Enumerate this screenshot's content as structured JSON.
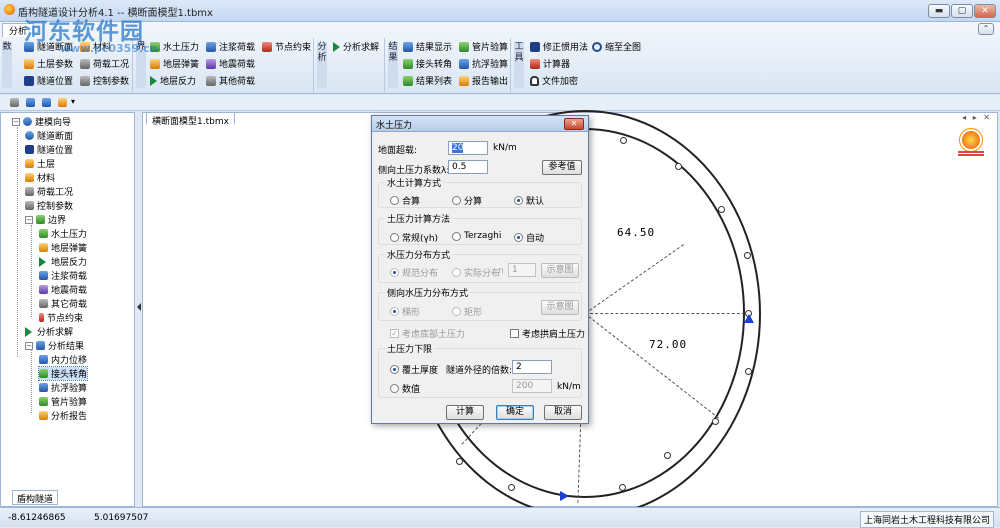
{
  "window": {
    "title": "盾构隧道设计分析4.1 -- 横断面模型1.tbmx",
    "min": "▬",
    "max": "▢",
    "close": "✕"
  },
  "watermark": {
    "text": "河东软件园",
    "url": "www.pc0359.cn"
  },
  "ribbon": {
    "tab": "分析",
    "groups": [
      {
        "label": "数",
        "items": [
          "隧道断面",
          "材料",
          "土层参数",
          "荷载工况",
          "隧道位置",
          "控制参数"
        ]
      },
      {
        "label": "界",
        "items": [
          "水土压力",
          "注浆荷载",
          "节点约束",
          "地层弹簧",
          "地震荷载",
          "地层反力",
          "其他荷载"
        ]
      },
      {
        "label": "分析",
        "items": [
          "分析求解"
        ]
      },
      {
        "label": "结果",
        "items": [
          "结果显示",
          "管片验算",
          "接头转角",
          "抗浮验算",
          "结果列表",
          "报告输出"
        ]
      },
      {
        "label": "工具",
        "items": [
          "修正惯用法",
          "缩至全图",
          "计算器",
          "文件加密"
        ]
      }
    ]
  },
  "tree": {
    "root": "建模向导",
    "items": [
      {
        "label": "隧道断面",
        "icon": "ring-icon"
      },
      {
        "label": "隧道位置",
        "icon": "tunnel-icon"
      },
      {
        "label": "土层",
        "icon": "soil-icon"
      },
      {
        "label": "材料",
        "icon": "material-icon"
      },
      {
        "label": "荷载工况",
        "icon": "loadcase-icon"
      },
      {
        "label": "控制参数",
        "icon": "control-icon"
      }
    ],
    "boundary": "边界",
    "boundary_items": [
      "水土压力",
      "地层弹簧",
      "地层反力",
      "注浆荷载",
      "地震荷载",
      "其它荷载",
      "节点约束"
    ],
    "solve": "分析求解",
    "results": "分析结果",
    "result_items": [
      "内力位移",
      "接头转角",
      "抗浮验算",
      "管片验算",
      "分析报告"
    ],
    "selected": "接头转角",
    "bottom_tab": "盾构隧道"
  },
  "doc_tab": "横断面模型1.tbmx",
  "tab_nav": "◂ ▸ ✕",
  "canvas": {
    "load_labels": [
      "64.50",
      "72.00"
    ]
  },
  "statusbar": {
    "x": "-8.61246865",
    "y": "5.01697507",
    "company": "上海同岩土木工程科技有限公司"
  },
  "dialog": {
    "title": "水土压力",
    "surcharge_label": "地面超载:",
    "surcharge_value": "20",
    "surcharge_unit": "kN/m",
    "lateral_label": "侧向土压力系数λ:",
    "lateral_value": "0.5",
    "ref_button": "参考值",
    "calc_mode": {
      "title": "水土计算方式",
      "options": [
        "合算",
        "分算",
        "默认"
      ],
      "selected": 2
    },
    "earth_method": {
      "title": "土压力计算方法",
      "options": [
        "常规(γh)",
        "Terzaghi",
        "自动"
      ],
      "selected": 2
    },
    "water_dist": {
      "title": "水压力分布方式",
      "options": [
        "规范分布",
        "实际分布"
      ],
      "count_label": "n",
      "count_value": "1",
      "demo": "示意图"
    },
    "side_water": {
      "title": "侧向水压力分布方式",
      "options": [
        "梯形",
        "矩形"
      ],
      "demo": "示意图"
    },
    "checks": [
      "考虑底部土压力",
      "考虑拱肩土压力"
    ],
    "lower_limit": {
      "title": "土压力下限",
      "opt1": "覆土厚度",
      "ratio_label": "隧道外径的倍数:",
      "ratio_value": "2",
      "opt2": "数值",
      "value": "200",
      "unit": "kN/m"
    },
    "buttons": [
      "计算",
      "确定",
      "取消"
    ]
  }
}
